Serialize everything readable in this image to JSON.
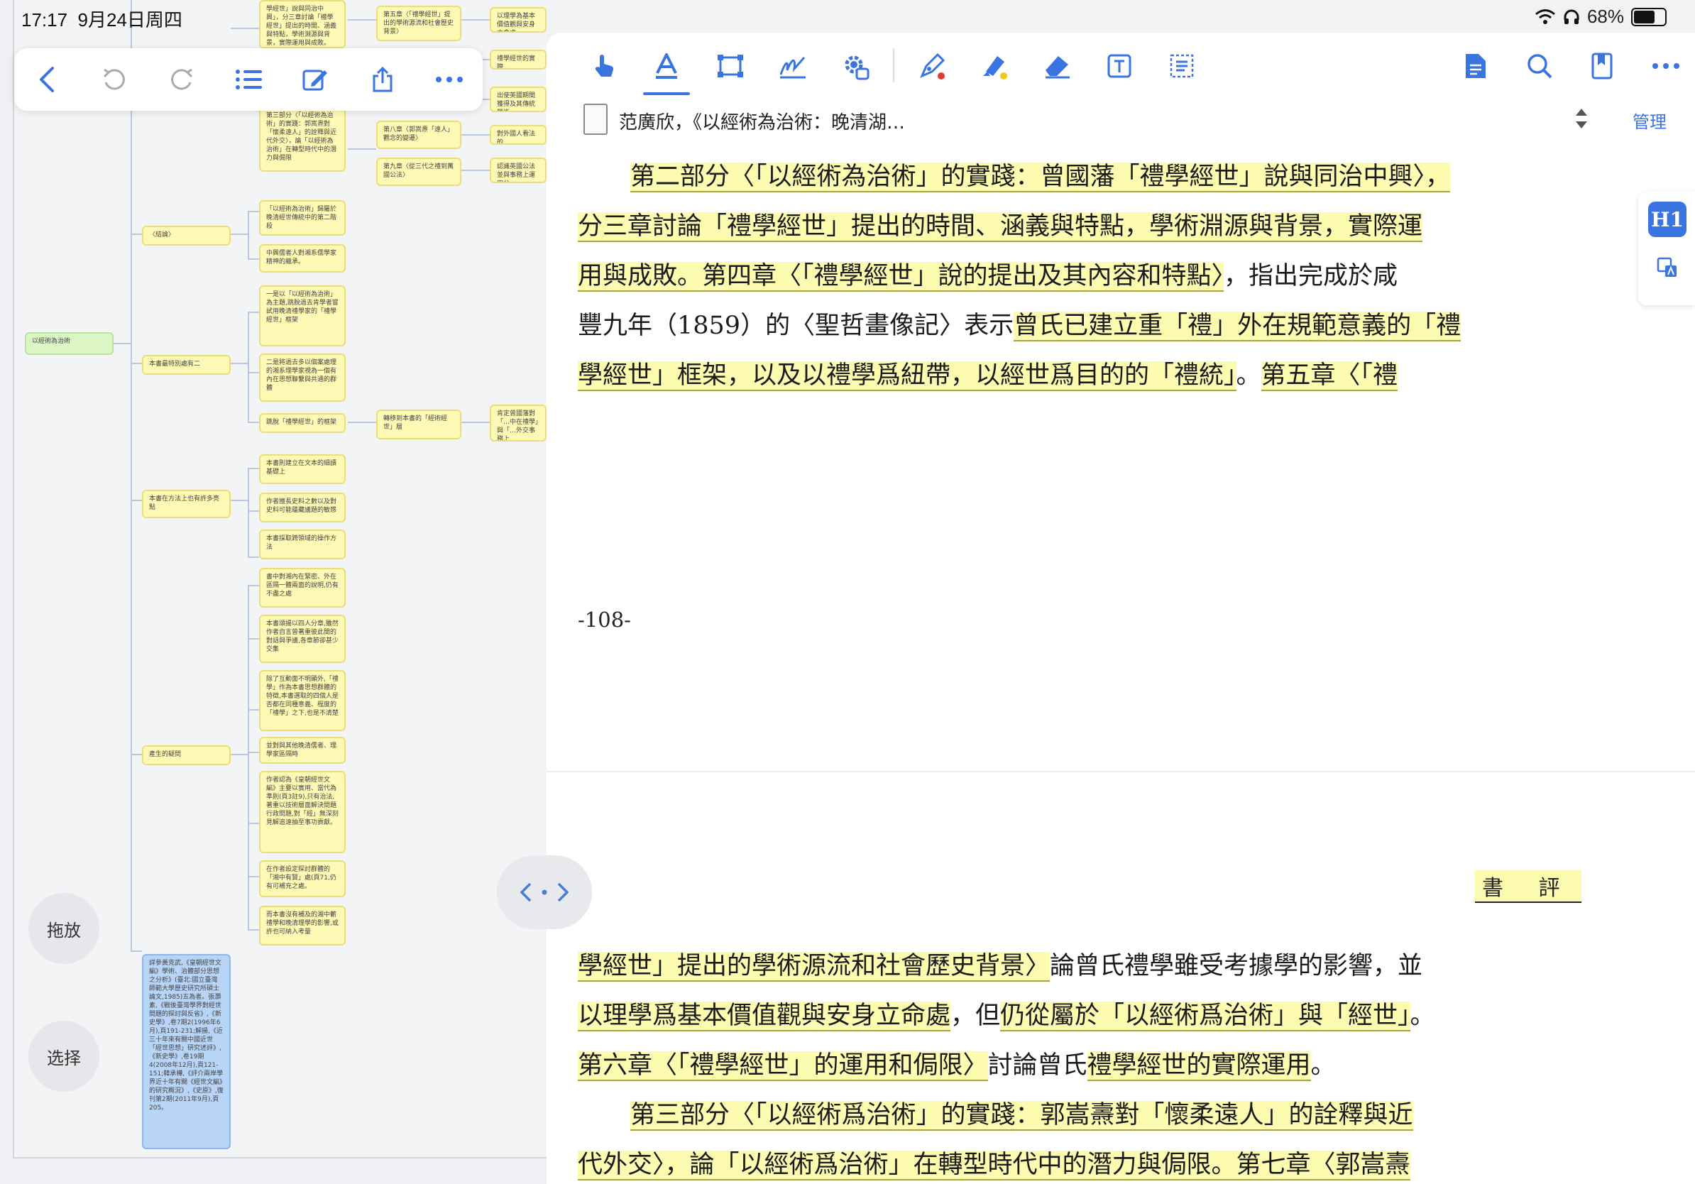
{
  "status_bar": {
    "time": "17:17",
    "date": "9月24日周四",
    "battery": "68%",
    "battery_level": 0.68
  },
  "mindmap": {
    "root": "以經術為治術",
    "nodes": [
      "學經世」說與同治中興」，分三章討論「禮學經世」提出的時間、涵義與特點，學術淵源與背景，實際運用與成敗。",
      "第五章〈「禮學經世」提出的學術源流和社會歷史背景〉",
      "以理學為基本價值觀與安身立命處",
      "禮學經世的實際…",
      "出使英國期間獲得及其傳統學術",
      "對外國人看法的",
      "認識英國公法並與事務上運用公…",
      "第三部分〈「以經術為治術」的實踐：郭嵩燾對「懷柔遠人」的詮釋與近代外交〉，論「以經術為治術」在轉型時代中的潛力與侷限",
      "第八章〈郭嵩燾「遠人」觀念的變遷〉",
      "第九章〈從三代之禮到萬國公法〉",
      "〈結論〉",
      "「以經術為治術」歸屬於晚清經世傳統中的第二階段",
      "中興儒者人對湘系儒學家精神的繼承。",
      "一是以「以經術為治術」為主題,跳脫過去肯學者嘗試用晚清禮學家的「禮學經世」框架",
      "本書最特別處有二",
      "二是將過去多以個案處理的湘系理學家視為一個有內在思想聯繫與共通的群體",
      "跳脫「禮學經世」的框架",
      "轉移到本書的「經術經世」層",
      "肯定曾國藩對「…中在禮學」與「…外交事務上…",
      "本書在方法上也有許多亮點",
      "本書則建立在文本的細讀基礎上",
      "作者擅長史料之數以及對史料可能蘊藏議題的敏感",
      "本書採取跨領域的操作方法",
      "產生的疑問",
      "書中對湘內在緊密、外在區隔一體兩面的說明,仍有不盡之處",
      "本書頌揚以四人分章,雖然作者自言曾著重彼此間的對話與爭議,各章節卻甚少交集",
      "除了互動面不明顯外,「禮學」作為本書思想群體的特徵,本書選取的四個人是否都在同種意義、程度的「禮學」之下,也是不清楚",
      "並對與其他晚清儒者、理學家區隔時",
      "作者認為《皇朝經世文編》主要以實用、當代為準則(頁3註9),只有治法,著重以技術層面解決問題行政問題,對「經」無深刻見解追遠抽至事功貢獻。",
      "在作者設定探討群體的「湘中有賢」處(頁71,仍有可補充之處。",
      "而本書沒有補及的湘中蘄禮學和晚清理學的影響,或許也可納入考量",
      "詳參黃克武,《皇朝經世文編》學術、治體部分思想之分析》(臺北:國立臺灣師範大學歷史研究所碩士論文,1985)五為者。張灝素,《戰後臺灣學界對經世問題的探討與反省》,《新史學》,卷7期2(1996年6月),頁191-231;解揚,《近三十年來有關中國近世「經世思想」研究述評》,《新史學》,卷19期4(2008年12月),頁121-151;韓承樺,《評介兩岸學界近十年有關《經世文編》的研究概況》,《史原》,復刊第2期(2011年9月),頁205。"
    ]
  },
  "left_toolbar": {
    "back": "back-icon",
    "undo": "undo-icon",
    "redo": "redo-icon",
    "list": "list-icon",
    "edit": "edit-icon",
    "share": "share-icon",
    "more": "more-icon"
  },
  "side_buttons": {
    "drag": "拖放",
    "select": "选择"
  },
  "right_toolbar": {
    "left_tools": [
      "hand-icon",
      "text-annotate-icon",
      "rectangle-select-icon",
      "sign-icon",
      "settings-gear-icon",
      "pen-icon",
      "highlighter-icon",
      "eraser-icon",
      "textbox-icon",
      "ocr-icon"
    ],
    "right_tools": [
      "document-icon",
      "search-icon",
      "bookmark-icon",
      "more-icon"
    ],
    "pen_dot_color": "#e53935",
    "highlighter_dot_color": "#f5c518",
    "accent": "#3a74e0"
  },
  "doc": {
    "title": "范廣欣，《以經術為治術：晚清湖…",
    "manage": "管理"
  },
  "page1": {
    "lines": [
      {
        "indent": true,
        "text": "第二部分〈「以經術為治術」的實踐：曾國藩「禮學經世」說與同治中興〉，",
        "hl": true
      },
      {
        "text": "分三章討論「禮學經世」提出的時間、涵義與特點，學術淵源與背景，實際運",
        "hl": true
      },
      {
        "text": "用與成敗。第四章〈「禮學經世」說的提出及其內容和特點〉",
        "hl": true,
        "tail": "，指出完成於咸"
      },
      {
        "text": "豐九年（1859）的〈聖哲畫像記〉表示",
        "hl": false,
        "tail_hl": "曾氏已建立重「禮」外在規範意義的「禮"
      },
      {
        "text": "學經世」框架，以及以禮學爲紐帶，以經世爲目的的「禮統」",
        "hl": true,
        "tail": "。",
        "tail2_hl": "第五章〈「禮"
      }
    ],
    "page_number": "-108-"
  },
  "page2": {
    "header": "書 評",
    "lines": [
      {
        "text": "學經世」提出的學術源流和社會歷史背景〉",
        "hl": true,
        "tail": "論曾氏禮學雖受考據學的影響，並"
      },
      {
        "text": "以理學爲基本價值觀與安身立命處",
        "hl": true,
        "tail": "，但",
        "tail2_hl": "仍從屬於「以經術爲治術」與「經世」",
        "tail3": "。"
      },
      {
        "text": "第六章〈「禮學經世」的運用和侷限〉",
        "hl": true,
        "tail": "討論曾氏",
        "tail2_hl": "禮學經世的實際運用",
        "tail3": "。"
      },
      {
        "indent": true,
        "text": "第三部分〈「以經術爲治術」的實踐：郭嵩燾對「懷柔遠人」的詮釋與近",
        "hl": true
      },
      {
        "text": "代外交〉，論「以經術爲治術」在轉型時代中的潛力與侷限。",
        "hl": true,
        "tail2_hl": "第七章〈郭嵩燾"
      }
    ]
  },
  "floating_panel": {
    "h1": "H1",
    "translate": "translate-icon"
  }
}
